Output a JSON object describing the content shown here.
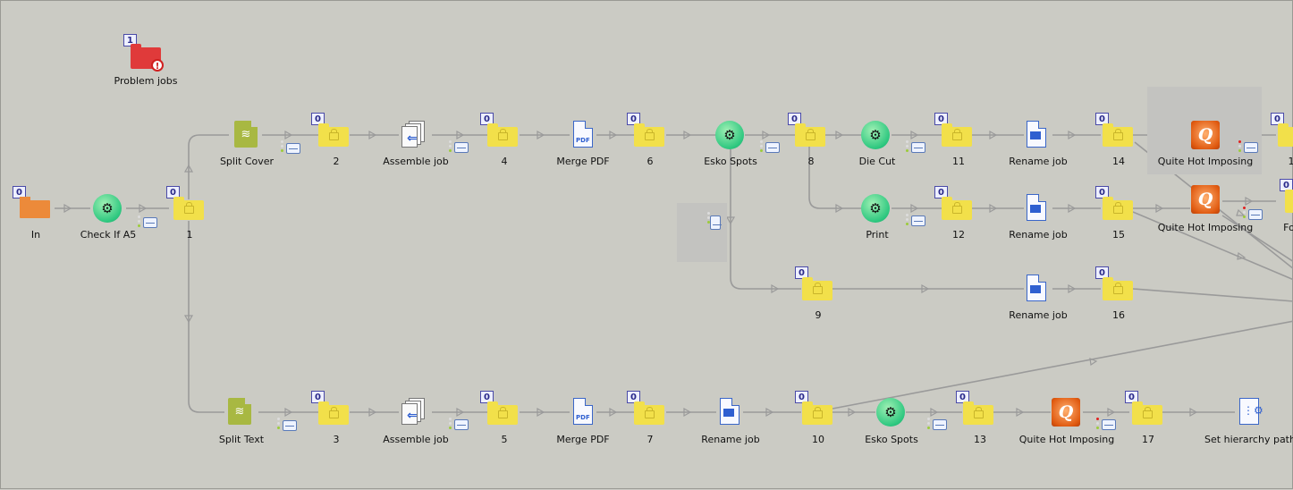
{
  "flow": {
    "problem": {
      "label": "Problem jobs",
      "count": "1"
    },
    "in": {
      "label": "In",
      "count": "0"
    },
    "check": {
      "label": "Check If A5"
    },
    "f1": {
      "label": "1",
      "count": "0"
    },
    "split_cover": {
      "label": "Split Cover"
    },
    "f2": {
      "label": "2",
      "count": "0"
    },
    "assemble_1": {
      "label": "Assemble job"
    },
    "f4": {
      "label": "4",
      "count": "0"
    },
    "merge_1": {
      "label": "Merge PDF"
    },
    "f6": {
      "label": "6",
      "count": "0"
    },
    "esko_1": {
      "label": "Esko Spots"
    },
    "f8": {
      "label": "8",
      "count": "0"
    },
    "diecut": {
      "label": "Die Cut"
    },
    "f11": {
      "label": "11",
      "count": "0"
    },
    "rename_1": {
      "label": "Rename job"
    },
    "f14": {
      "label": "14",
      "count": "0"
    },
    "qhi_1": {
      "label": "Quite Hot Imposing"
    },
    "f_right_top": {
      "label": "1",
      "count": "0"
    },
    "print": {
      "label": "Print"
    },
    "f12": {
      "label": "12",
      "count": "0"
    },
    "rename_2": {
      "label": "Rename job"
    },
    "f15": {
      "label": "15",
      "count": "0"
    },
    "qhi_2": {
      "label": "Quite Hot Imposing"
    },
    "f_right_mid": {
      "label": "Fol",
      "count": "0"
    },
    "f9": {
      "label": "9",
      "count": "0"
    },
    "rename_3": {
      "label": "Rename job"
    },
    "f16": {
      "label": "16",
      "count": "0"
    },
    "split_text": {
      "label": "Split Text"
    },
    "f3": {
      "label": "3",
      "count": "0"
    },
    "assemble_2": {
      "label": "Assemble job"
    },
    "f5": {
      "label": "5",
      "count": "0"
    },
    "merge_2": {
      "label": "Merge PDF"
    },
    "f7": {
      "label": "7",
      "count": "0"
    },
    "rename_4": {
      "label": "Rename job"
    },
    "f10": {
      "label": "10",
      "count": "0"
    },
    "esko_2": {
      "label": "Esko Spots"
    },
    "f13": {
      "label": "13",
      "count": "0"
    },
    "qhi_3": {
      "label": "Quite Hot Imposing"
    },
    "f17": {
      "label": "17",
      "count": "0"
    },
    "hierarchy": {
      "label": "Set hierarchy path"
    }
  },
  "colors": {
    "canvas": "#cbcbc4",
    "connector": "#9a9a9a",
    "folder": "#f2e04a",
    "problem_folder": "#e03a3a",
    "input_folder": "#ec8a3a",
    "gear": "#2dc77f",
    "quite_hot": "#e05a10",
    "document_blue": "#2f5fd0",
    "split": "#a8b842"
  },
  "icons": {
    "folder": "yellow-locked-folder-icon",
    "problem": "problem-folder-icon",
    "input": "input-folder-icon",
    "gear": "gear-script-icon",
    "merge": "pdf-document-icon",
    "rename": "rename-document-icon",
    "assemble": "assemble-job-icon",
    "split": "split-layers-icon",
    "qhi": "quite-hot-imposing-icon",
    "hierarchy": "hierarchy-icon"
  }
}
